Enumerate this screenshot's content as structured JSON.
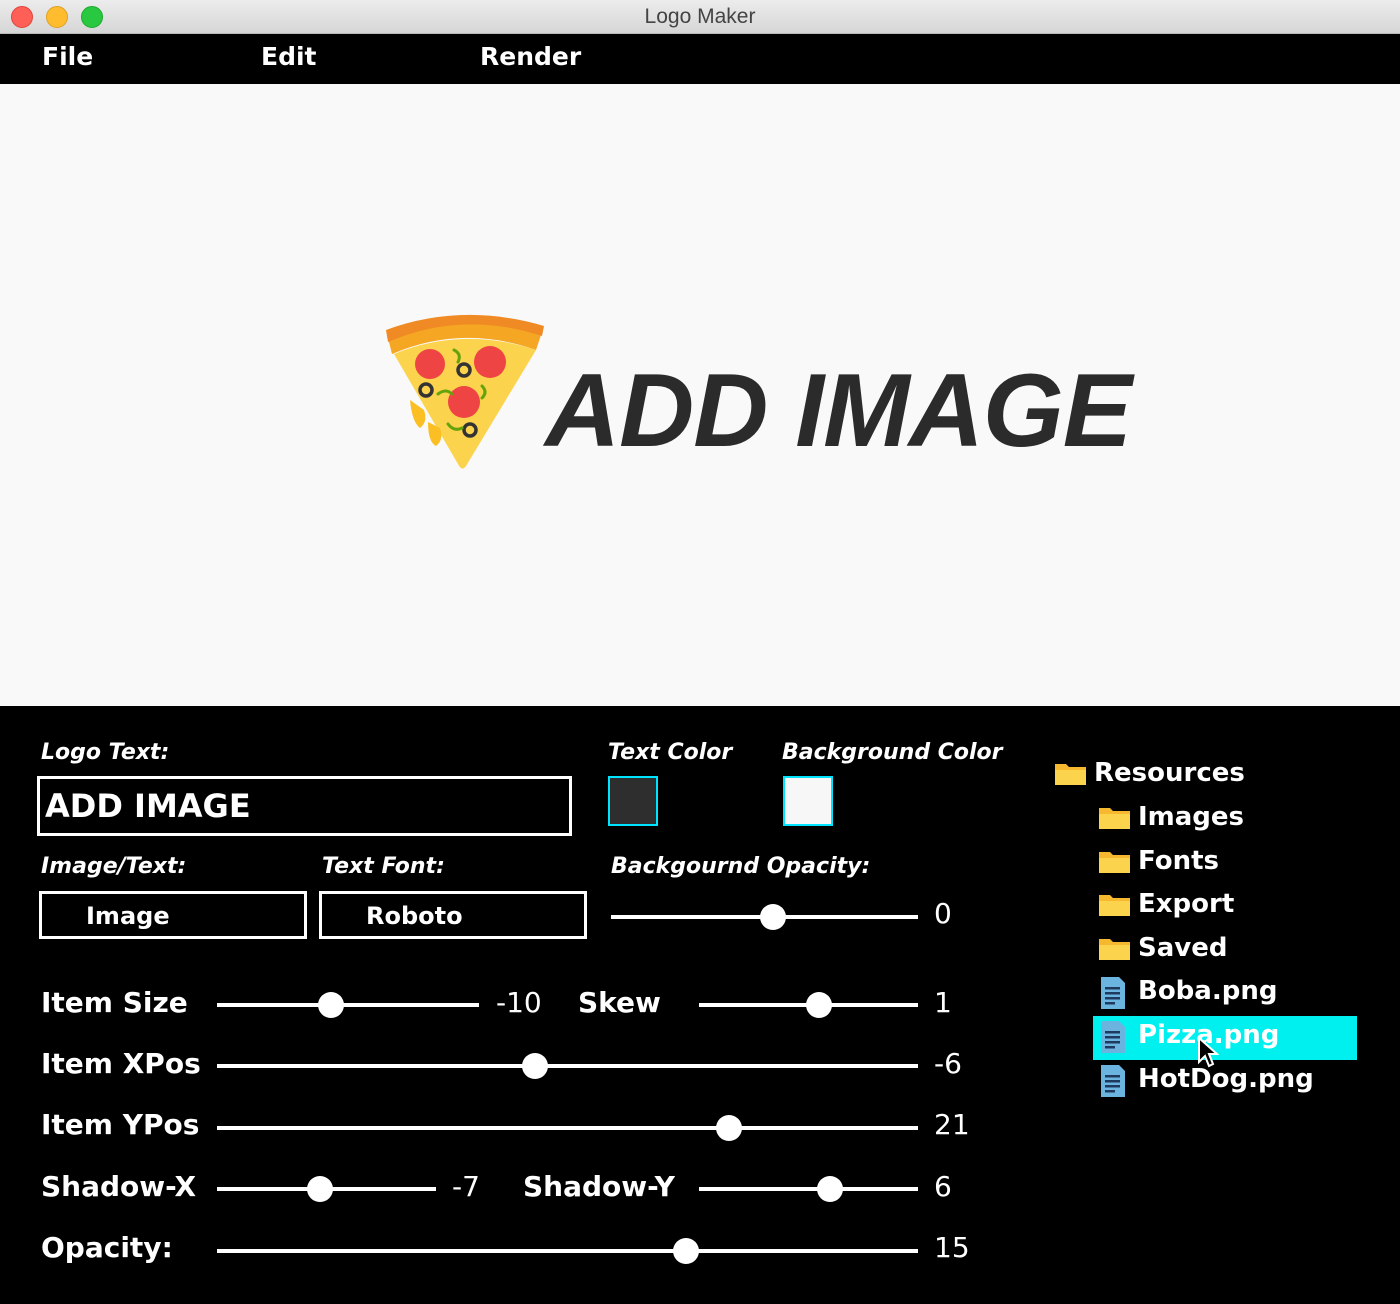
{
  "window": {
    "title": "Logo Maker"
  },
  "menu": {
    "file": "File",
    "edit": "Edit",
    "render": "Render"
  },
  "preview": {
    "logo_text": "ADD IMAGE",
    "image": "pizza"
  },
  "controls": {
    "logo_text_label": "Logo Text:",
    "logo_text_value": "ADD IMAGE",
    "text_color_label": "Text Color",
    "text_color": "#2e2e2e",
    "background_color_label": "Background Color",
    "background_color": "#f7f7f7",
    "image_text_label": "Image/Text:",
    "image_text_value": "Image",
    "text_font_label": "Text Font:",
    "text_font_value": "Roboto",
    "bg_opacity_label": "Backgournd Opacity:",
    "bg_opacity_value": "0",
    "item_size_label": "Item Size",
    "item_size_value": "-10",
    "skew_label": "Skew",
    "skew_value": "1",
    "item_xpos_label": "Item XPos",
    "item_xpos_value": "-6",
    "item_ypos_label": "Item YPos",
    "item_ypos_value": "21",
    "shadow_x_label": "Shadow-X",
    "shadow_x_value": "-7",
    "shadow_y_label": "Shadow-Y",
    "shadow_y_value": "6",
    "opacity_label": "Opacity:",
    "opacity_value": "15"
  },
  "resources": {
    "root": "Resources",
    "folders": [
      "Images",
      "Fonts",
      "Export",
      "Saved"
    ],
    "files": [
      "Boba.png",
      "Pizza.png",
      "HotDog.png"
    ],
    "selected": "Pizza.png",
    "selection_color": "#00f0f0"
  }
}
